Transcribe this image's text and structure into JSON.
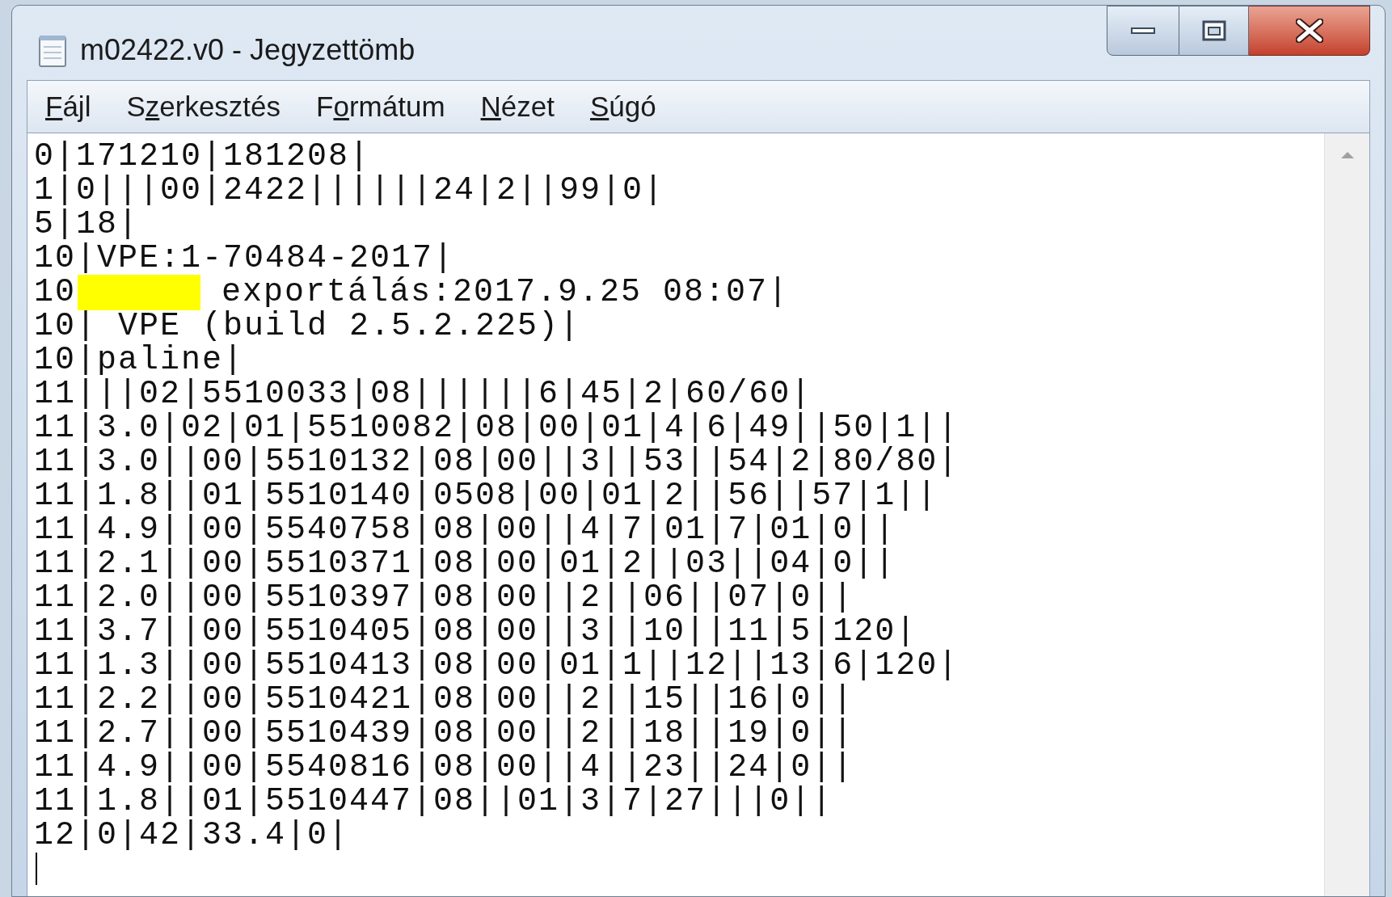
{
  "window": {
    "title": "m02422.v0 - Jegyzettömb"
  },
  "menu": [
    {
      "key": "F",
      "after": "ájl"
    },
    {
      "before": "S",
      "key": "z",
      "after": "erkesztés"
    },
    {
      "before": "F",
      "key": "o",
      "after": "rmátum"
    },
    {
      "key": "N",
      "after": "ézet"
    },
    {
      "key": "S",
      "after": "úgó"
    }
  ],
  "lines": [
    {
      "text": "0|171210|181208|"
    },
    {
      "text": "1|0|||00|2422||||||24|2||99|0|"
    },
    {
      "text": "5|18|"
    },
    {
      "text": "10|VPE:1-70484-2017|"
    },
    {
      "text": "10",
      "after_redaction": " exportálás:2017.9.25 08:07|"
    },
    {
      "text": "10| VPE (build 2.5.2.225)|"
    },
    {
      "text": "10|paline|"
    },
    {
      "text": "11|||02|5510033|08||||||6|45|2|60/60|"
    },
    {
      "text": "11|3.0|02|01|5510082|08|00|01|4|6|49||50|1||"
    },
    {
      "text": "11|3.0||00|5510132|08|00||3||53||54|2|80/80|"
    },
    {
      "text": "11|1.8||01|5510140|0508|00|01|2||56||57|1||"
    },
    {
      "text": "11|4.9||00|5540758|08|00||4|7|01|7|01|0||"
    },
    {
      "text": "11|2.1||00|5510371|08|00|01|2||03||04|0||"
    },
    {
      "text": "11|2.0||00|5510397|08|00||2||06||07|0||"
    },
    {
      "text": "11|3.7||00|5510405|08|00||3||10||11|5|120|"
    },
    {
      "text": "11|1.3||00|5510413|08|00|01|1||12||13|6|120|"
    },
    {
      "text": "11|2.2||00|5510421|08|00||2||15||16|0||"
    },
    {
      "text": "11|2.7||00|5510439|08|00||2||18||19|0||"
    },
    {
      "text": "11|4.9||00|5540816|08|00||4||23||24|0||"
    },
    {
      "text": "11|1.8||01|5510447|08||01|3|7|27|||0||"
    },
    {
      "text": "12|0|42|33.4|0|"
    }
  ]
}
